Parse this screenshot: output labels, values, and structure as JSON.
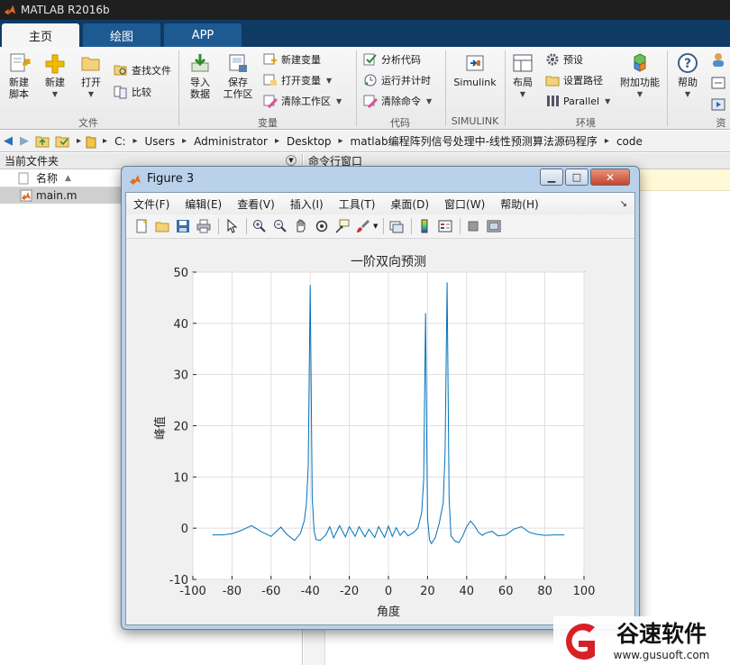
{
  "app": {
    "title": "MATLAB R2016b"
  },
  "tabs": [
    {
      "label": "主页",
      "active": true
    },
    {
      "label": "绘图",
      "active": false
    },
    {
      "label": "APP",
      "active": false
    }
  ],
  "ribbon": {
    "file": {
      "new_script": "新建\n脚本",
      "new": "新建",
      "open": "打开",
      "find_files": "查找文件",
      "compare": "比较",
      "group_label": "文件"
    },
    "variable": {
      "import_data": "导入\n数据",
      "save_workspace": "保存\n工作区",
      "new_variable": "新建变量",
      "open_variable": "打开变量",
      "clear_workspace": "清除工作区",
      "group_label": "变量"
    },
    "code": {
      "analyze_code": "分析代码",
      "run_and_time": "运行并计时",
      "clear_commands": "清除命令",
      "group_label": "代码"
    },
    "simulink": {
      "button": "Simulink",
      "group_label": "SIMULINK"
    },
    "environment": {
      "layout": "布局",
      "preferences": "预设",
      "set_path": "设置路径",
      "parallel": "Parallel",
      "addons": "附加功能",
      "group_label": "环境"
    },
    "resources": {
      "help": "帮助",
      "group_label": "资"
    }
  },
  "address_bar": {
    "path": [
      "C:",
      "Users",
      "Administrator",
      "Desktop",
      "matlab编程阵列信号处理中-线性预测算法源码程序",
      "code"
    ]
  },
  "current_folder": {
    "title": "当前文件夹",
    "column_name": "名称",
    "sort_indicator": "▲",
    "files": [
      {
        "name": "main.m"
      }
    ]
  },
  "command_window": {
    "title": "命令行窗口"
  },
  "figure": {
    "window_title": "Figure 3",
    "menu": [
      "文件(F)",
      "编辑(E)",
      "查看(V)",
      "插入(I)",
      "工具(T)",
      "桌面(D)",
      "窗口(W)",
      "帮助(H)"
    ],
    "toolbar_icons": [
      "new-figure-icon",
      "open-file-icon",
      "save-icon",
      "print-icon",
      "pointer-icon",
      "zoom-in-icon",
      "zoom-out-icon",
      "pan-icon",
      "rotate-icon",
      "data-cursor-icon",
      "brush-icon",
      "link-plot-icon",
      "colorbar-icon",
      "legend-icon",
      "hide-plot-tools-icon",
      "show-plot-tools-icon"
    ]
  },
  "chart_data": {
    "type": "line",
    "title": "一阶双向预测",
    "xlabel": "角度",
    "ylabel": "峰值",
    "xlim": [
      -100,
      100
    ],
    "ylim": [
      -10,
      50
    ],
    "xticks": [
      -100,
      -80,
      -60,
      -40,
      -20,
      0,
      20,
      40,
      60,
      80,
      100
    ],
    "yticks": [
      -10,
      0,
      10,
      20,
      30,
      40,
      50
    ],
    "grid": true,
    "line_color": "#0072bd",
    "series": [
      {
        "x": [
          -90,
          -85,
          -80,
          -75,
          -70,
          -65,
          -60,
          -55,
          -52,
          -48,
          -45,
          -43,
          -42,
          -41,
          -40,
          -39,
          -38,
          -37,
          -35,
          -32,
          -30,
          -28,
          -25,
          -22,
          -20,
          -17,
          -15,
          -12,
          -10,
          -7,
          -5,
          -2,
          0,
          2,
          4,
          6,
          8,
          10,
          13,
          15,
          17,
          18,
          19,
          20,
          21,
          22,
          24,
          26,
          28,
          29,
          30,
          31,
          32,
          34,
          36,
          38,
          40,
          42,
          44,
          46,
          48,
          50,
          53,
          56,
          60,
          64,
          68,
          72,
          76,
          80,
          85,
          90
        ],
        "y": [
          -1.3,
          -1.3,
          -1.1,
          -0.4,
          0.5,
          -0.7,
          -1.6,
          0.2,
          -1.2,
          -2.4,
          -1.0,
          1.5,
          4.5,
          12.0,
          47.5,
          6.0,
          -0.5,
          -2.2,
          -2.4,
          -1.3,
          0.3,
          -1.9,
          0.5,
          -1.7,
          0.3,
          -1.6,
          0.3,
          -1.7,
          -0.2,
          -1.8,
          0.3,
          -1.8,
          0.4,
          -1.6,
          0.1,
          -1.4,
          -0.5,
          -1.5,
          -0.8,
          0.0,
          3.0,
          9.5,
          42.0,
          2.0,
          -2.3,
          -3.0,
          -1.8,
          1.0,
          5.0,
          15.0,
          48.0,
          6.0,
          -1.5,
          -2.5,
          -2.8,
          -1.5,
          0.3,
          1.4,
          0.5,
          -0.8,
          -1.4,
          -0.9,
          -0.6,
          -1.5,
          -1.3,
          -0.2,
          0.3,
          -0.8,
          -1.2,
          -1.4,
          -1.3,
          -1.3
        ]
      }
    ]
  },
  "watermark": {
    "brand": "谷速软件",
    "url": "www.gusuoft.com",
    "accent": "#d91f26"
  }
}
